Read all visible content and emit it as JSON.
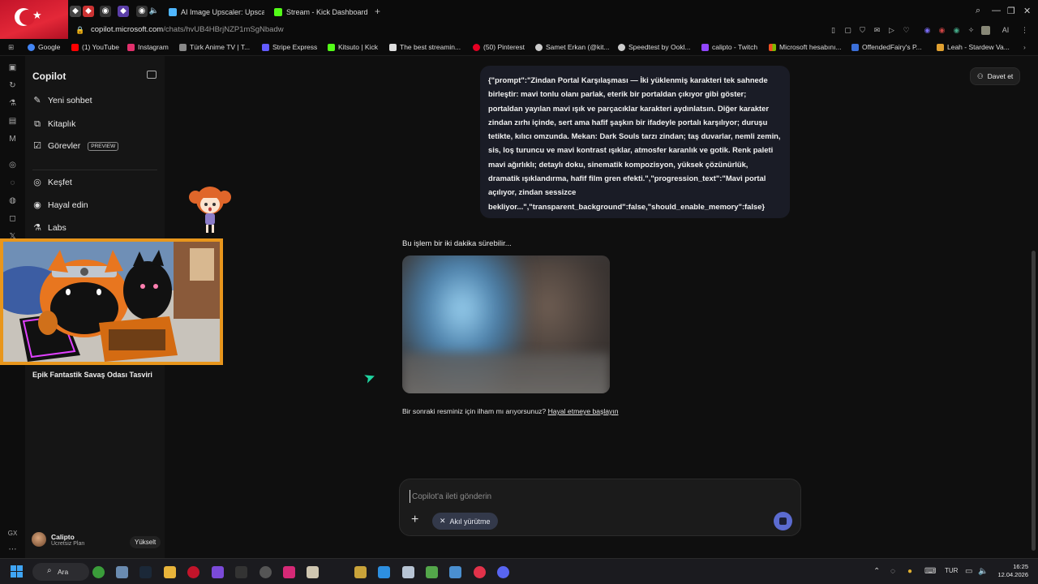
{
  "browser": {
    "tabs": [
      {
        "title": "AI Image Upscaler: Upsca",
        "icon": "upscaler-icon",
        "color": "#4fb7ff"
      },
      {
        "title": "Stream - Kick Dashboard",
        "icon": "kick-icon",
        "color": "#53fc18"
      }
    ],
    "new_tab": "+",
    "url_host": "copilot.microsoft.com",
    "url_path": "/chats/hvUB4HBrjNZP1mSgNbadw",
    "bookmarks": [
      {
        "label": "Google",
        "icon": "google-icon",
        "color": "#4285f4"
      },
      {
        "label": "(1) YouTube",
        "icon": "youtube-icon",
        "color": "#ff0000"
      },
      {
        "label": "Instagram",
        "icon": "instagram-icon",
        "color": "#e1306c"
      },
      {
        "label": "Türk Anime TV | T...",
        "icon": "turkanime-icon",
        "color": "#888888"
      },
      {
        "label": "Stripe Express",
        "icon": "stripe-icon",
        "color": "#635bff"
      },
      {
        "label": "Kitsuto | Kick",
        "icon": "kick-icon",
        "color": "#53fc18"
      },
      {
        "label": "The best streamin...",
        "icon": "stream-icon",
        "color": "#dddddd"
      },
      {
        "label": "(50) Pinterest",
        "icon": "pinterest-icon",
        "color": "#e60023"
      },
      {
        "label": "Samet Erkan (@kit...",
        "icon": "threads-icon",
        "color": "#cccccc"
      },
      {
        "label": "Speedtest by Ookl...",
        "icon": "speedtest-icon",
        "color": "#cccccc"
      },
      {
        "label": "calipto - Twitch",
        "icon": "twitch-icon",
        "color": "#9146ff"
      },
      {
        "label": "Microsoft hesabını...",
        "icon": "microsoft-icon",
        "color": "#f25022"
      },
      {
        "label": "OffendedFairy's P...",
        "icon": "profile-icon",
        "color": "#3b6fd8"
      },
      {
        "label": "Leah - Stardew Va...",
        "icon": "stardew-icon",
        "color": "#e0a030"
      }
    ]
  },
  "sidebar": {
    "title": "Copilot",
    "items": [
      {
        "label": "Yeni sohbet",
        "icon": "new-chat-icon"
      },
      {
        "label": "Kitaplık",
        "icon": "library-icon"
      },
      {
        "label": "Görevler",
        "icon": "tasks-icon",
        "badge": "PREVIEW"
      },
      {
        "label": "Keşfet",
        "icon": "discover-icon"
      },
      {
        "label": "Hayal edin",
        "icon": "imagine-icon"
      },
      {
        "label": "Labs",
        "icon": "labs-icon"
      }
    ],
    "conversation": "Epik Fantastik Savaş Odası Tasviri",
    "user": {
      "name": "Calipto",
      "plan": "Ücretsiz Plan"
    },
    "upgrade": "Yükselt"
  },
  "main": {
    "invite": "Davet et",
    "user_message": "{\"prompt\":\"Zindan Portal Karşılaşması — İki yüklenmiş karakteri tek sahnede birleştir: mavi tonlu olanı parlak, eterik bir portaldan çıkıyor gibi göster; portaldan yayılan mavi ışık ve parçacıklar karakteri aydınlatsın. Diğer karakter zindan zırhı içinde, sert ama hafif şaşkın bir ifadeyle portalı karşılıyor; duruşu tetikte, kılıcı omzunda. Mekan: Dark Souls tarzı zindan; taş duvarlar, nemli zemin, sis, loş turuncu ve mavi kontrast ışıklar, atmosfer karanlık ve gotik. Renk paleti mavi ağırlıklı; detaylı doku, sinematik kompozisyon, yüksek çözünürlük, dramatik ışıklandırma, hafif film gren efekti.\",\"progression_text\":\"Mavi portal açılıyor, zindan sessizce bekliyor...\",\"transparent_background\":false,\"should_enable_memory\":false}",
    "status": "Bu işlem bir iki dakika sürebilir...",
    "inspire_text": "Bir sonraki resminiz için ilham mı arıyorsunuz?",
    "inspire_link": "Hayal etmeye başlayın"
  },
  "composer": {
    "placeholder": "Copilot'a ileti gönderin",
    "chip": "Akıl yürütme",
    "accent": "#5b6bd0"
  },
  "taskbar": {
    "search": "Ara",
    "language": "TUR",
    "time": "16:25",
    "date": "12.04.2026"
  }
}
